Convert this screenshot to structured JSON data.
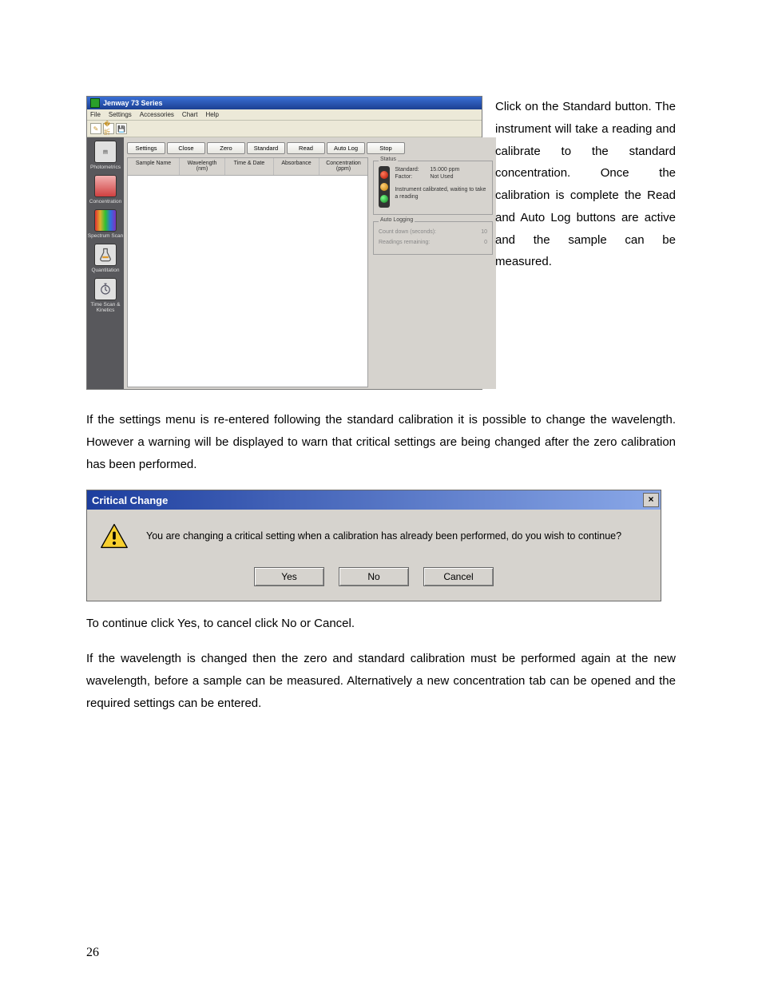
{
  "app": {
    "title": "Jenway 73 Series",
    "menus": [
      "File",
      "Settings",
      "Accessories",
      "Chart",
      "Help"
    ],
    "quick": [
      "new",
      "open",
      "save"
    ],
    "sidebar": [
      {
        "label": "Photometrics"
      },
      {
        "label": "Concentration"
      },
      {
        "label": "Spectrum Scan"
      },
      {
        "label": "Quantitation"
      },
      {
        "label": "Time Scan & Kinetics"
      }
    ],
    "buttons": [
      "Settings",
      "Close",
      "Zero",
      "Standard",
      "Read",
      "Auto Log",
      "Stop"
    ],
    "columns": [
      "Sample Name",
      "Wavelength (nm)",
      "Time & Date",
      "Absorbance",
      "Concentration (ppm)"
    ],
    "status": {
      "group_title": "Status",
      "standard_label": "Standard:",
      "standard_value": "15.000 ppm",
      "factor_label": "Factor:",
      "factor_value": "Not Used",
      "message": "Instrument calibrated, waiting to take a reading"
    },
    "autolog": {
      "group_title": "Auto Logging",
      "countdown_label": "Count down (seconds):",
      "countdown_value": "10",
      "remaining_label": "Readings remaining:",
      "remaining_value": "0"
    }
  },
  "dialog": {
    "title": "Critical Change",
    "message": "You are changing a critical setting when a calibration has already been performed, do you wish to continue?",
    "yes": "Yes",
    "no": "No",
    "cancel": "Cancel",
    "close_x": "×"
  },
  "text": {
    "side_para": "Click on the Standard button. The instrument will take a reading and calibrate to the standard concentration. Once the calibration is complete the Read and Auto Log buttons are active and the sample can be measured.",
    "full_para_1": "If the settings menu is re-entered following the standard calibration it is possible to change the wavelength. However a warning will be displayed to warn that critical settings are being changed after the zero calibration has been performed.",
    "after_dialog_1": "To continue click Yes, to cancel click No or Cancel.",
    "after_dialog_2": "If the wavelength is changed then the zero and standard calibration must be performed again at the new wavelength, before a sample can be measured. Alternatively a new concentration tab can be opened and the required settings can be entered.",
    "page_number": "26"
  }
}
